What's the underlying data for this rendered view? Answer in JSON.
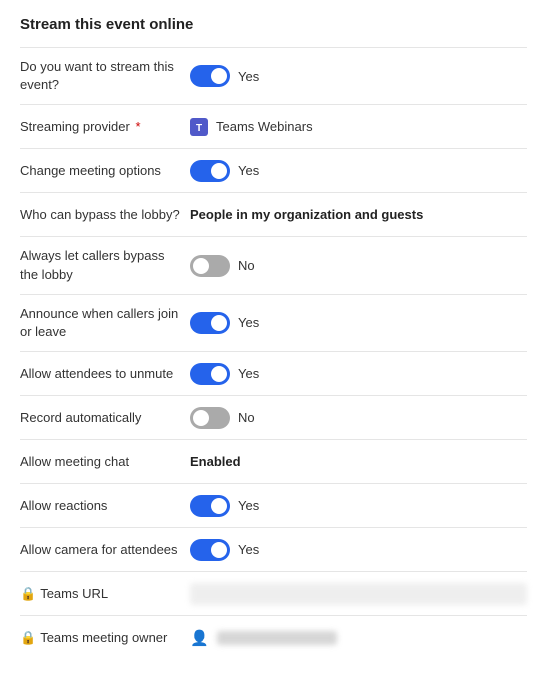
{
  "page": {
    "title": "Stream this event online"
  },
  "rows": [
    {
      "id": "stream-event",
      "label": "Do you want to stream this event?",
      "type": "toggle",
      "toggle_state": "on",
      "value_text": "Yes"
    },
    {
      "id": "streaming-provider",
      "label": "Streaming provider",
      "required": true,
      "type": "provider",
      "value_text": "Teams Webinars"
    },
    {
      "id": "change-meeting-options",
      "label": "Change meeting options",
      "type": "toggle",
      "toggle_state": "on",
      "value_text": "Yes"
    },
    {
      "id": "bypass-lobby",
      "label": "Who can bypass the lobby?",
      "type": "bold-text",
      "value_text": "People in my organization and guests"
    },
    {
      "id": "callers-bypass",
      "label": "Always let callers bypass the lobby",
      "type": "toggle",
      "toggle_state": "off",
      "value_text": "No"
    },
    {
      "id": "announce-callers",
      "label": "Announce when callers join or leave",
      "type": "toggle",
      "toggle_state": "on",
      "value_text": "Yes"
    },
    {
      "id": "allow-unmute",
      "label": "Allow attendees to unmute",
      "type": "toggle",
      "toggle_state": "on",
      "value_text": "Yes"
    },
    {
      "id": "record-auto",
      "label": "Record automatically",
      "type": "toggle",
      "toggle_state": "off",
      "value_text": "No"
    },
    {
      "id": "meeting-chat",
      "label": "Allow meeting chat",
      "type": "bold-text",
      "value_text": "Enabled"
    },
    {
      "id": "allow-reactions",
      "label": "Allow reactions",
      "type": "toggle",
      "toggle_state": "on",
      "value_text": "Yes"
    },
    {
      "id": "allow-camera",
      "label": "Allow camera for attendees",
      "type": "toggle",
      "toggle_state": "on",
      "value_text": "Yes"
    },
    {
      "id": "teams-url",
      "label": "Teams URL",
      "type": "url",
      "has_lock": true
    },
    {
      "id": "teams-owner",
      "label": "Teams meeting owner",
      "type": "owner",
      "has_lock": true
    }
  ],
  "icons": {
    "lock": "🔒",
    "person": "👤"
  }
}
